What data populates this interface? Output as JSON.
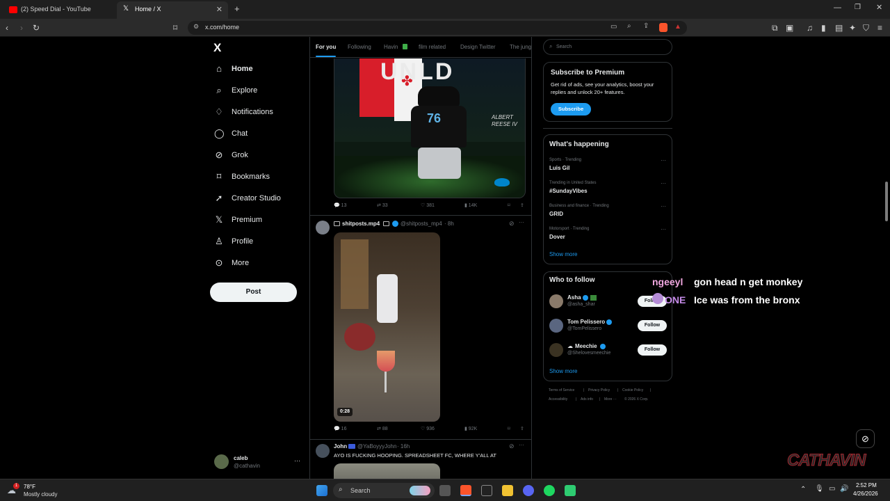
{
  "browser": {
    "tabs": [
      {
        "title": "(2) Speed Dial - YouTube"
      },
      {
        "title": "Home / X"
      }
    ],
    "new_tab": "+",
    "url": "x.com/home"
  },
  "nav": {
    "logo": "X",
    "items": [
      {
        "label": "Home",
        "icon": "home-icon"
      },
      {
        "label": "Explore",
        "icon": "search-icon"
      },
      {
        "label": "Notifications",
        "icon": "bell-icon"
      },
      {
        "label": "Chat",
        "icon": "chat-icon"
      },
      {
        "label": "Grok",
        "icon": "grok-icon"
      },
      {
        "label": "Bookmarks",
        "icon": "bookmark-icon"
      },
      {
        "label": "Creator Studio",
        "icon": "rocket-icon"
      },
      {
        "label": "Premium",
        "icon": "x-icon"
      },
      {
        "label": "Profile",
        "icon": "person-icon"
      },
      {
        "label": "More",
        "icon": "more-circle-icon"
      }
    ],
    "post_label": "Post",
    "account": {
      "name": "caleb",
      "handle": "@cathavin",
      "menu": "···"
    }
  },
  "feed": {
    "tabs": [
      "For you",
      "Following",
      "Havin",
      "film related",
      "Design Twitter",
      "The jung"
    ],
    "post1": {
      "image_text": [
        "ALBERT",
        "REESE IV"
      ],
      "jersey": "76",
      "actions": {
        "replies": "13",
        "reposts": "33",
        "likes": "381",
        "views": "14K"
      }
    },
    "post2": {
      "name": "shitposts.mp4",
      "handle": "@shitposts_mp4",
      "time": "· 8h",
      "video_duration": "0:28",
      "actions": {
        "replies": "16",
        "reposts": "88",
        "likes": "936",
        "views": "92K"
      }
    },
    "post3": {
      "name": "John",
      "handle": "@YaBoyyyJohn",
      "time": "· 16h",
      "text": "AYO IS FUCKING HOOPING. SPREADSHEET FC, WHERE Y'ALL AT"
    }
  },
  "sidebar": {
    "search_placeholder": "Search",
    "premium": {
      "title": "Subscribe to Premium",
      "body": "Get rid of ads, see your analytics, boost your replies and unlock 20+ features.",
      "button": "Subscribe"
    },
    "happening": {
      "title": "What's happening",
      "trends": [
        {
          "meta": "Sports · Trending",
          "name": "Luis Gil"
        },
        {
          "meta": "Trending in United States",
          "name": "#SundayVibes"
        },
        {
          "meta": "Business and finance · Trending",
          "name": "GRID"
        },
        {
          "meta": "Motorsport · Trending",
          "name": "Dover"
        }
      ],
      "show_more": "Show more"
    },
    "who_to_follow": {
      "title": "Who to follow",
      "accounts": [
        {
          "name": "Asha",
          "handle": "@asha_shar",
          "button": "Follow"
        },
        {
          "name": "Tom Pelissero",
          "handle": "@TomPelissero",
          "button": "Follow"
        },
        {
          "name": "Meechie",
          "handle": "@Shelovesmeechie",
          "button": "Follow"
        }
      ],
      "show_more": "Show more"
    },
    "footer": [
      "Terms of Service",
      "|",
      "Privacy Policy",
      "|",
      "Cookie Policy",
      "|",
      "Accessibility",
      "|",
      "Ads info",
      "|",
      "More ···",
      "© 2026 X Corp."
    ]
  },
  "stream_overlay": {
    "chat": [
      {
        "user": "ngeeyl",
        "message": "gon head n get monkey"
      },
      {
        "user": "ONE",
        "message": "Ice was from the bronx"
      }
    ],
    "logo": "CATHAVIN"
  },
  "taskbar": {
    "weather_temp": "78°F",
    "weather_desc": "Mostly cloudy",
    "weather_badge": "1",
    "search": "Search",
    "time": "2:52 PM",
    "date": "4/26/2026"
  },
  "colors": {
    "accent": "#1d9bf0",
    "background": "#000000",
    "border": "#2f3336",
    "muted": "#71767b"
  }
}
